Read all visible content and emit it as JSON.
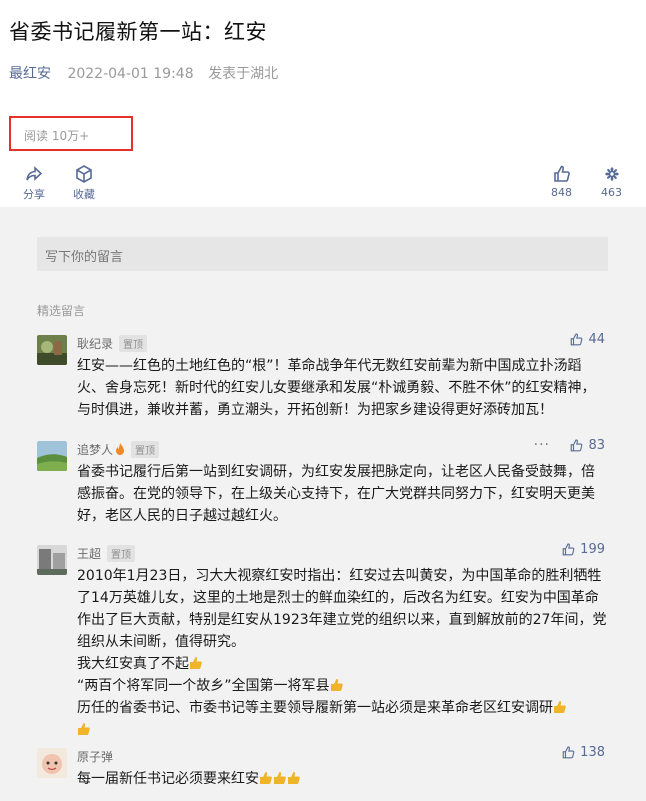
{
  "article": {
    "title": "省委书记履新第一站：红安",
    "author": "最红安",
    "datetime": "2022-04-01 19:48",
    "location": "发表于湖北",
    "reads": "阅读 10万+"
  },
  "actions": {
    "share": "分享",
    "favorite": "收藏",
    "like_count": "848",
    "wow_count": "463"
  },
  "comment_box": {
    "placeholder": "写下你的留言"
  },
  "section_label": "精选留言",
  "comments": [
    {
      "nickname": "耿纪录",
      "badge": "置顶",
      "likes": "44",
      "lines": [
        "红安——红色的土地红色的“根”！革命战争年代无数红安前辈为新中国成立扑汤蹈火、舍身忘死！新时代的红安儿女要继承和发展“朴诚勇毅、不胜不休”的红安精神，与时俱进，兼收并蓄，勇立潮头，开拓创新！为把家乡建设得更好添砖加瓦！"
      ]
    },
    {
      "nickname": "追梦人",
      "badge": "置顶",
      "likes": "83",
      "more": "···",
      "lines": [
        "省委书记履行后第一站到红安调研，为红安发展把脉定向，让老区人民备受鼓舞，倍感振奋。在党的领导下，在上级关心支持下，在广大党群共同努力下，红安明天更美好，老区人民的日子越过越红火。"
      ]
    },
    {
      "nickname": "王超",
      "badge": "置顶",
      "likes": "199",
      "lines": [
        "2010年1月23日，习大大视察红安时指出：红安过去叫黄安，为中国革命的胜利牺牲了14万英雄儿女，这里的土地是烈士的鲜血染红的，后改名为红安。红安为中国革命作出了巨大贡献，特别是红安从1923年建立党的组织以来，直到解放前的27年间，党组织从未间断，值得研究。",
        "我大红安真了不起",
        "“两百个将军同一个故乡”全国第一将军县",
        "历任的省委书记、市委书记等主要领导履新第一站必须是来革命老区红安调研"
      ]
    },
    {
      "nickname": "原子弹",
      "likes": "138",
      "lines": [
        "每一届新任书记必须要来红安"
      ]
    }
  ],
  "colors": {
    "link": "#576b95",
    "highlight_border": "#e8302a",
    "thumb_emoji": "#f0b429"
  }
}
